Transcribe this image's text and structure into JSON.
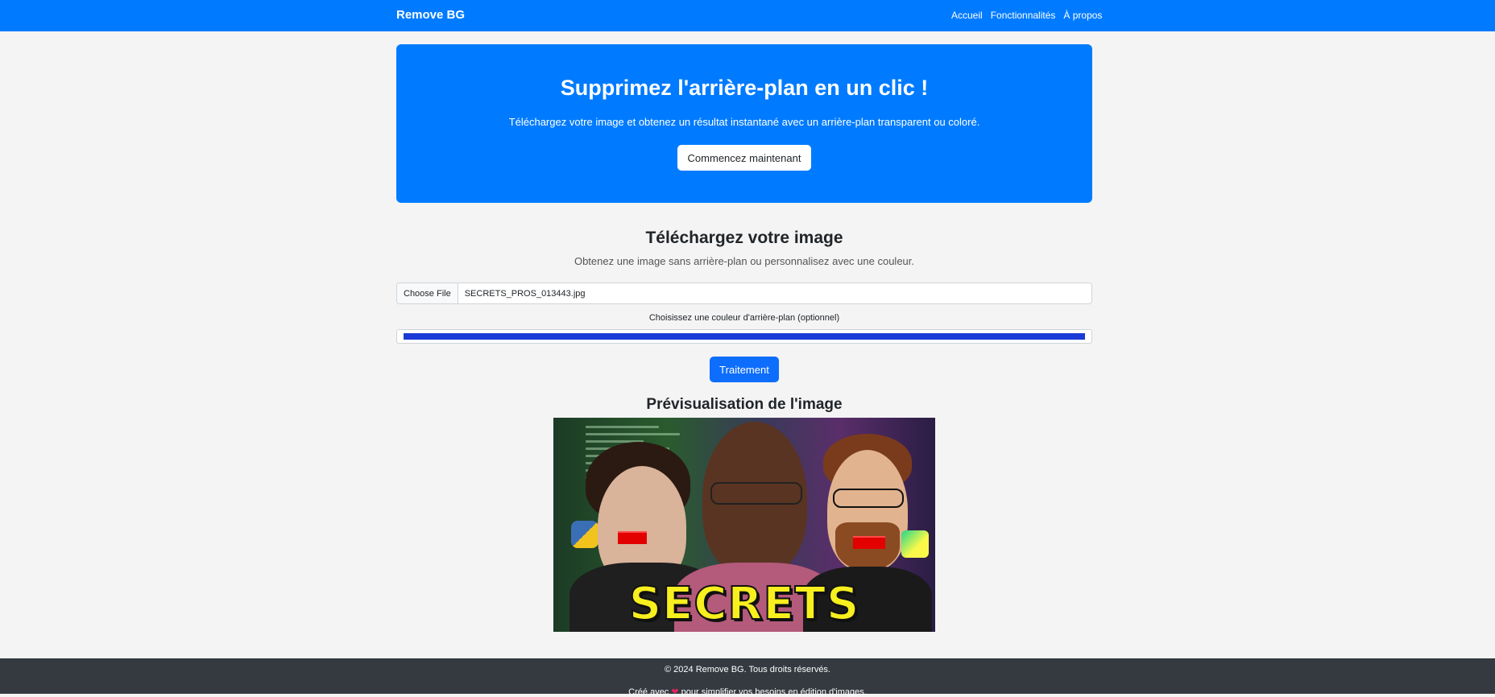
{
  "navbar": {
    "brand": "Remove BG",
    "links": [
      "Accueil",
      "Fonctionnalités",
      "À propos"
    ]
  },
  "hero": {
    "title": "Supprimez l'arrière-plan en un clic !",
    "subtitle": "Téléchargez votre image et obtenez un résultat instantané avec un arrière-plan transparent ou coloré.",
    "cta_label": "Commencez maintenant"
  },
  "upload": {
    "title": "Téléchargez votre image",
    "subtitle": "Obtenez une image sans arrière-plan ou personnalisez avec une couleur.",
    "file_button_label": "Choose File",
    "file_name": "SECRETS_PROS_013443.jpg",
    "color_label": "Choisissez une couleur d'arrière-plan (optionnel)",
    "color_value": "#1a3bd6",
    "process_label": "Traitement"
  },
  "preview": {
    "title": "Prévisualisation de l'image",
    "image_text": "SECRETS"
  },
  "footer": {
    "copyright": "© 2024 Remove BG. Tous droits réservés.",
    "tagline_prefix": "Créé avec",
    "tagline_suffix": "pour simplifier vos besoins en édition d'images."
  },
  "colors": {
    "primary": "#007bff",
    "button_primary": "#0d6efd",
    "footer_bg": "#343a40",
    "page_bg": "#f4f4f4"
  }
}
